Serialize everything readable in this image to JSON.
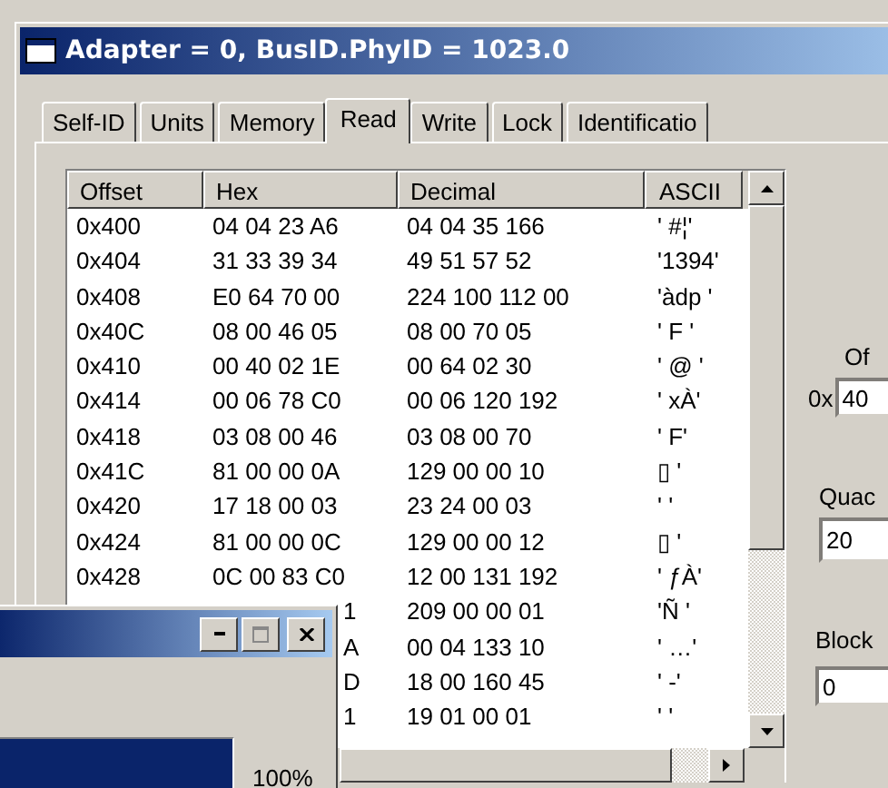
{
  "window": {
    "title": "Adapter = 0, BusID.PhyID = 1023.0"
  },
  "tabs": [
    {
      "label": "Self-ID",
      "selected": false
    },
    {
      "label": "Units",
      "selected": false
    },
    {
      "label": "Memory",
      "selected": false
    },
    {
      "label": "Read",
      "selected": true
    },
    {
      "label": "Write",
      "selected": false
    },
    {
      "label": "Lock",
      "selected": false
    },
    {
      "label": "Identificatio",
      "selected": false
    }
  ],
  "memory_list": {
    "columns": [
      "Offset",
      "Hex",
      "Decimal",
      "ASCII"
    ],
    "rows": [
      {
        "kind": "full",
        "offset": "0x400",
        "hex": "04 04 23 A6",
        "decimal": "04 04 35 166",
        "ascii": "'  #¦'"
      },
      {
        "kind": "full",
        "offset": "0x404",
        "hex": "31 33 39 34",
        "decimal": "49 51 57 52",
        "ascii": "'1394'"
      },
      {
        "kind": "full",
        "offset": "0x408",
        "hex": "E0 64 70 00",
        "decimal": "224 100 112 00",
        "ascii": "'àdp '"
      },
      {
        "kind": "full",
        "offset": "0x40C",
        "hex": "08 00 46 05",
        "decimal": "08 00 70 05",
        "ascii": "'  F '"
      },
      {
        "kind": "full",
        "offset": "0x410",
        "hex": "00 40 02 1E",
        "decimal": "00 64 02 30",
        "ascii": "' @  '"
      },
      {
        "kind": "full",
        "offset": "0x414",
        "hex": "00 06 78 C0",
        "decimal": "00 06 120 192",
        "ascii": "'  xÀ'"
      },
      {
        "kind": "full",
        "offset": "0x418",
        "hex": "03 08 00 46",
        "decimal": "03 08 00 70",
        "ascii": "'   F'"
      },
      {
        "kind": "full",
        "offset": "0x41C",
        "hex": "81 00 00 0A",
        "decimal": "129 00 00 10",
        "ascii": "▯   '"
      },
      {
        "kind": "full",
        "offset": "0x420",
        "hex": "17 18 00 03",
        "decimal": "23 24 00 03",
        "ascii": "'    '"
      },
      {
        "kind": "full",
        "offset": "0x424",
        "hex": "81 00 00 0C",
        "decimal": "129 00 00 12",
        "ascii": "▯   '"
      },
      {
        "kind": "full",
        "offset": "0x428",
        "hex": "0C 00 83 C0",
        "decimal": "12 00 131 192",
        "ascii": "'  ƒÀ'"
      },
      {
        "kind": "covered",
        "hex": "1",
        "decimal": "209 00 00 01",
        "ascii": "'Ñ   '"
      },
      {
        "kind": "covered",
        "hex": "A",
        "decimal": "00 04 133 10",
        "ascii": "'  …'"
      },
      {
        "kind": "covered",
        "hex": "D",
        "decimal": "18 00 160 45",
        "ascii": "'  -'"
      },
      {
        "kind": "covered",
        "hex": "1",
        "decimal": "19 01 00 01",
        "ascii": "'    '"
      }
    ]
  },
  "side_panel": {
    "offset_label": "Of",
    "offset_prefix": "0x",
    "offset_value": "40",
    "quadlets_label": "Quac",
    "quadlets_value": "20",
    "block_label": "Block",
    "block_value": "0"
  },
  "progress_window": {
    "level": 1,
    "reading": "100%"
  }
}
